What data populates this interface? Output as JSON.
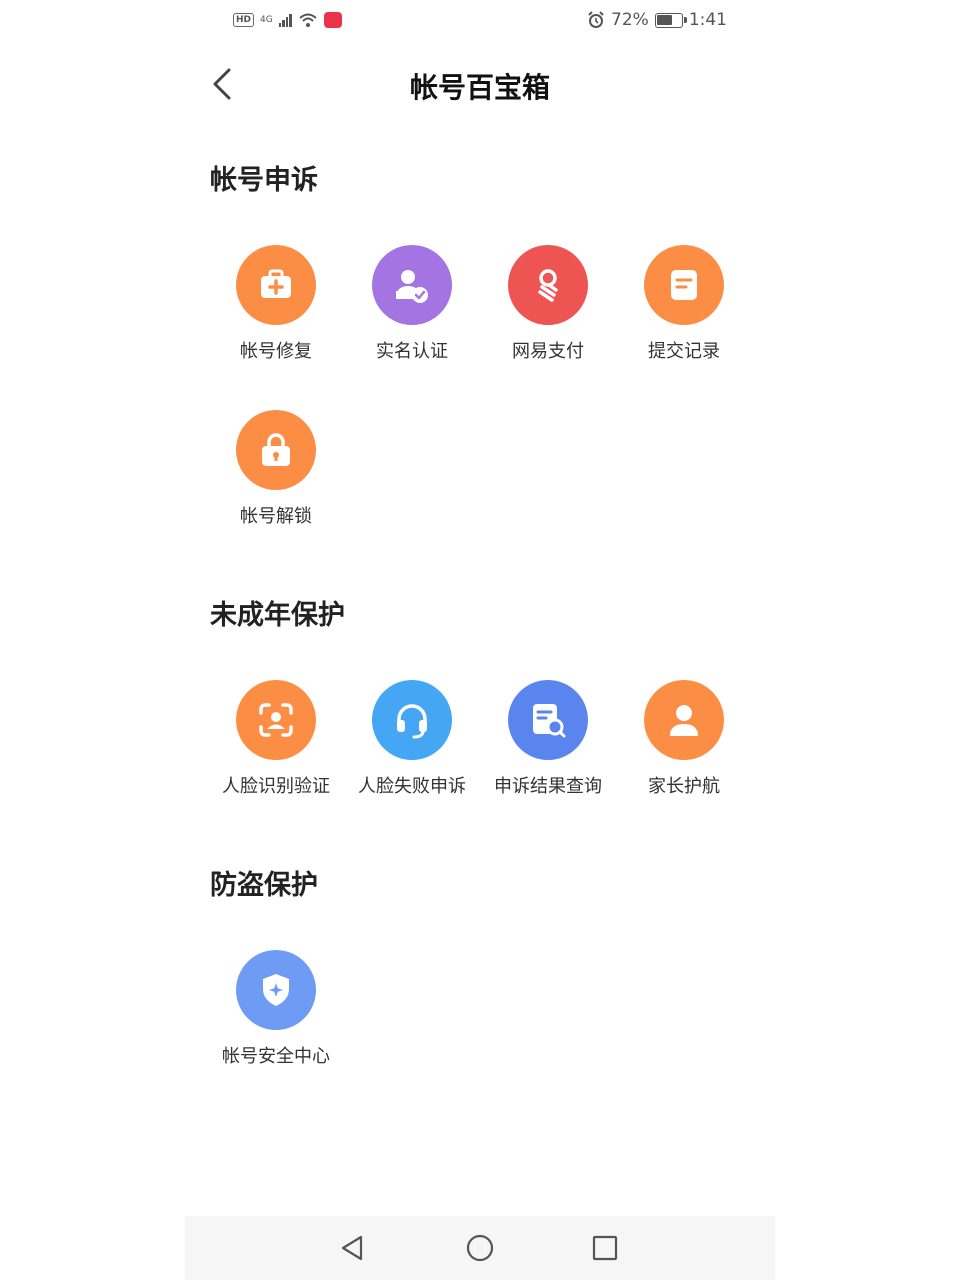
{
  "status_bar": {
    "hd": "HD",
    "network": "4G",
    "battery": "72%",
    "battery_level": 0.72,
    "time": "1:41"
  },
  "header": {
    "title": "帐号百宝箱"
  },
  "sections": [
    {
      "title": "帐号申诉",
      "items": [
        {
          "label": "帐号修复",
          "icon": "medical-kit-icon",
          "color": "#fb8d45"
        },
        {
          "label": "实名认证",
          "icon": "user-verified-icon",
          "color": "#a474e3"
        },
        {
          "label": "网易支付",
          "icon": "netease-pay-icon",
          "color": "#ee5452"
        },
        {
          "label": "提交记录",
          "icon": "document-icon",
          "color": "#fb8d45"
        },
        {
          "label": "帐号解锁",
          "icon": "lock-icon",
          "color": "#fb8d45"
        }
      ]
    },
    {
      "title": "未成年保护",
      "items": [
        {
          "label": "人脸识别验证",
          "icon": "face-scan-icon",
          "color": "#fb8d45"
        },
        {
          "label": "人脸失败申诉",
          "icon": "headset-icon",
          "color": "#45a6f4"
        },
        {
          "label": "申诉结果查询",
          "icon": "document-search-icon",
          "color": "#5a84ee"
        },
        {
          "label": "家长护航",
          "icon": "person-icon",
          "color": "#fb8d45"
        }
      ]
    },
    {
      "title": "防盗保护",
      "items": [
        {
          "label": "帐号安全中心",
          "icon": "shield-icon",
          "color": "#6e9cf4"
        }
      ]
    }
  ]
}
